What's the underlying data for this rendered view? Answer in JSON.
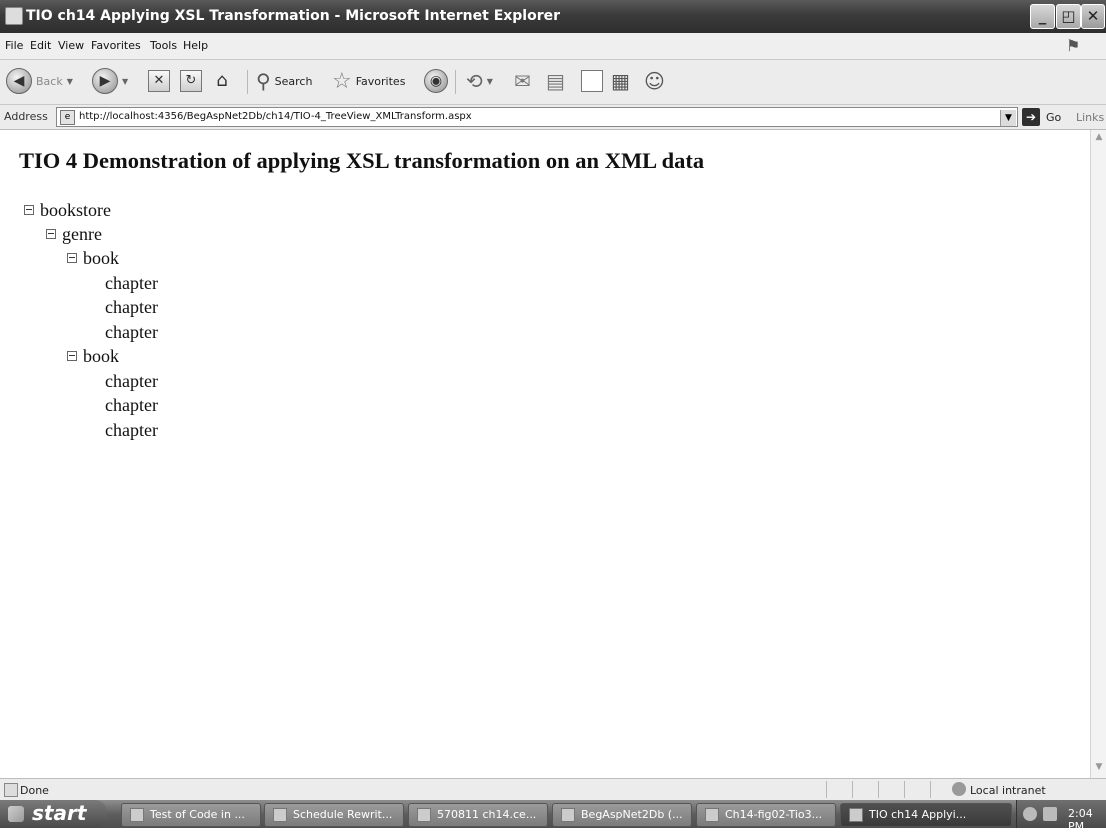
{
  "window": {
    "title": "TIO ch14 Applying XSL Transformation - Microsoft Internet Explorer",
    "buttons": [
      "_",
      "◰",
      "✕"
    ]
  },
  "menu": [
    "File",
    "Edit",
    "View",
    "Favorites",
    "Tools",
    "Help"
  ],
  "toolbar": {
    "back": "Back",
    "search": "Search",
    "favorites": "Favorites"
  },
  "address": {
    "label": "Address",
    "url": "http://localhost:4356/BegAspNet2Db/ch14/TIO-4_TreeView_XMLTransform.aspx",
    "go": "Go",
    "links": "Links"
  },
  "page": {
    "heading": "TIO 4 Demonstration of applying XSL transformation on an XML data",
    "tree": {
      "root": "bookstore",
      "genre": "genre",
      "books": [
        {
          "label": "book",
          "chapters": [
            "chapter",
            "chapter",
            "chapter"
          ]
        },
        {
          "label": "book",
          "chapters": [
            "chapter",
            "chapter",
            "chapter"
          ]
        }
      ]
    }
  },
  "status": {
    "text": "Done",
    "zone": "Local intranet"
  },
  "taskbar": {
    "start": "start",
    "tasks": [
      "Test of Code in ...",
      "Schedule Rewrit...",
      "570811 ch14.ce...",
      "BegAspNet2Db (...",
      "Ch14-fig02-Tio3...",
      "TIO ch14 Applyi..."
    ],
    "clock": "2:04 PM"
  },
  "colors": {
    "titlebar": "#3b3b3b",
    "chrome": "#ececec",
    "taskbar": "#5e5e5e"
  }
}
